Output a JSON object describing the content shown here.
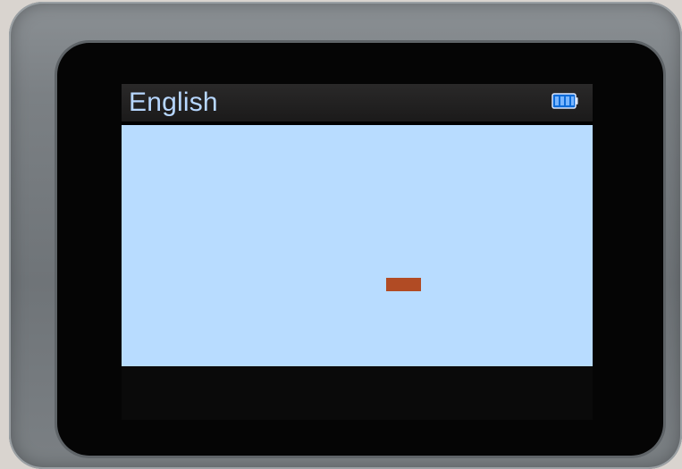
{
  "screen": {
    "title": "English",
    "battery_icon": "battery-icon",
    "content": {
      "indicator_color": "#b14b24"
    }
  }
}
